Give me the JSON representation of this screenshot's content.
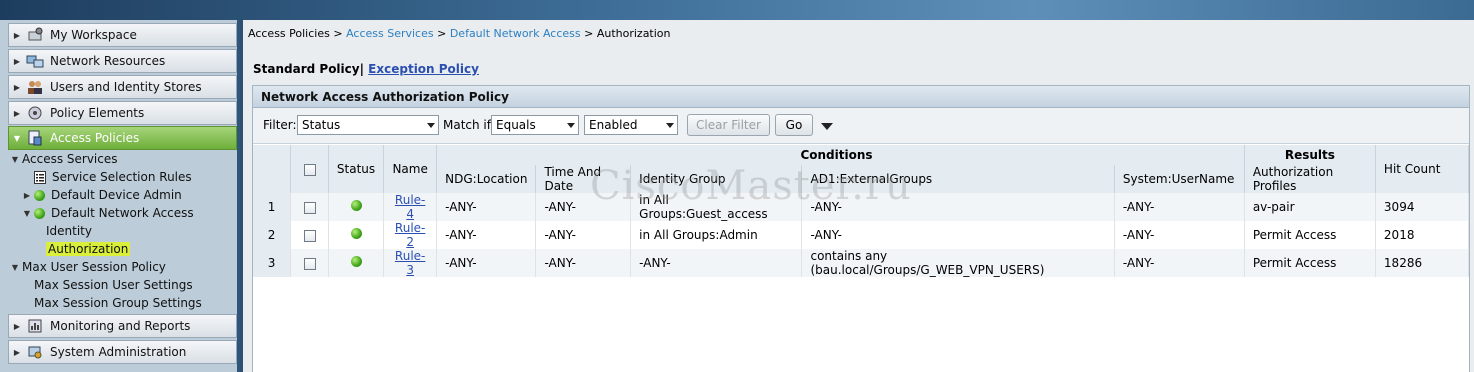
{
  "nav": {
    "drawers": [
      {
        "label": "My Workspace",
        "icon": "workspace-icon"
      },
      {
        "label": "Network Resources",
        "icon": "network-resources-icon"
      },
      {
        "label": "Users and Identity Stores",
        "icon": "users-icon"
      },
      {
        "label": "Policy Elements",
        "icon": "policy-elements-icon"
      },
      {
        "label": "Access Policies",
        "icon": "access-policies-icon"
      },
      {
        "label": "Monitoring and Reports",
        "icon": "monitoring-icon"
      },
      {
        "label": "System Administration",
        "icon": "system-admin-icon"
      }
    ],
    "tree": {
      "access_services": "Access Services",
      "service_selection_rules": "Service Selection Rules",
      "default_device_admin": "Default Device Admin",
      "default_network_access": "Default Network Access",
      "identity": "Identity",
      "authorization": "Authorization",
      "max_user_session_policy": "Max User Session Policy",
      "max_session_user_settings": "Max Session User Settings",
      "max_session_group_settings": "Max Session Group Settings"
    }
  },
  "breadcrumb": {
    "item1": "Access Policies",
    "sep": ">",
    "item2": "Access Services",
    "item3": "Default Network Access",
    "item4": "Authorization"
  },
  "policy_tabs": {
    "standard": "Standard Policy|",
    "exception": "Exception Policy"
  },
  "panel_title": "Network Access Authorization Policy",
  "filter": {
    "label": "Filter:",
    "field": "Status",
    "match_label": "Match if:",
    "operator": "Equals",
    "value": "Enabled",
    "clear_button": "Clear Filter",
    "go_button": "Go"
  },
  "table": {
    "group_conditions": "Conditions",
    "group_results": "Results",
    "col_status": "Status",
    "col_name": "Name",
    "col_ndg": "NDG:Location",
    "col_time": "Time And Date",
    "col_identity": "Identity Group",
    "col_ad": "AD1:ExternalGroups",
    "col_user": "System:UserName",
    "col_profiles": "Authorization Profiles",
    "col_hits": "Hit Count",
    "rows": [
      {
        "num": "1",
        "name": "Rule-4",
        "ndg": "-ANY-",
        "time": "-ANY-",
        "identity": "in All Groups:Guest_access",
        "ad": "-ANY-",
        "user": "-ANY-",
        "profile": "av-pair",
        "hits": "3094"
      },
      {
        "num": "2",
        "name": "Rule-2",
        "ndg": "-ANY-",
        "time": "-ANY-",
        "identity": "in All Groups:Admin",
        "ad": "-ANY-",
        "user": "-ANY-",
        "profile": "Permit Access",
        "hits": "2018"
      },
      {
        "num": "3",
        "name": "Rule-3",
        "ndg": "-ANY-",
        "time": "-ANY-",
        "identity": "-ANY-",
        "ad": "contains any (bau.local/Groups/G_WEB_VPN_USERS)",
        "user": "-ANY-",
        "profile": "Permit Access",
        "hits": "18286"
      }
    ]
  },
  "watermark": "CiscoMaster.ru"
}
